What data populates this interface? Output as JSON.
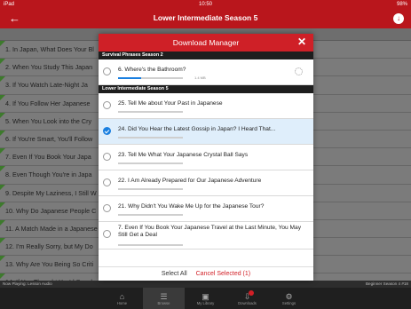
{
  "status": {
    "carrier": "iPad",
    "time": "10:50",
    "battery": "98%"
  },
  "navbar": {
    "title": "Lower Intermediate Season 5",
    "back_icon": "back-arrow-icon",
    "download_icon": "download-icon"
  },
  "background_list": [
    "1. In Japan, What Does Your Bl",
    "2. When You Study This Japan",
    "3. If You Watch Late-Night Ja",
    "4. If You Follow Her Japanese",
    "5. When You Look into the Cry",
    "6. If You're Smart, You'll Follow",
    "7. Even If You Book Your Japa",
    "8. Even Though You're in Japa",
    "9. Despite My Laziness, I Still W",
    "10. Why Do Japanese People C",
    "11. A Match Made in a Japanese",
    "12. I'm Really Sorry, but My Do",
    "13. Why Are You Being So Criti",
    "14. If You Thought You'd Speak"
  ],
  "modal": {
    "title": "Download Manager",
    "close_icon": "close-icon",
    "sections": [
      {
        "name": "Survival Phrases Season 2",
        "items": [
          {
            "label": "6. Where's the Bathroom?",
            "size": "1.4 MB",
            "progress": 0.35,
            "downloading": true,
            "selected": false
          }
        ]
      },
      {
        "name": "Lower Intermediate Season 5",
        "items": [
          {
            "label": "25. Tell Me about Your Past in Japanese",
            "progress": 0,
            "selected": false
          },
          {
            "label": "24. Did You Hear the Latest Gossip in Japan? I Heard That...",
            "progress": 0,
            "selected": true
          },
          {
            "label": "23. Tell Me What Your Japanese Crystal Ball Says",
            "progress": 0,
            "selected": false
          },
          {
            "label": "22. I Am Already Prepared for Our Japanese Adventure",
            "progress": 0,
            "selected": false
          },
          {
            "label": "21. Why Didn't You Wake Me Up for the Japanese Tour?",
            "progress": 0,
            "selected": false
          },
          {
            "label": "7. Even If You Book Your Japanese Travel at the Last Minute, You May Still Get a Deal",
            "progress": 0,
            "selected": false
          }
        ]
      }
    ],
    "select_all": "Select All",
    "cancel_selected": "Cancel Selected (1)"
  },
  "now_playing": {
    "left": "Now Playing: Lesson Audio",
    "right": "Beginner Season 4 #18"
  },
  "tabs": [
    {
      "label": "Home",
      "icon": "home-icon",
      "active": false
    },
    {
      "label": "Browse",
      "icon": "browse-icon",
      "active": true
    },
    {
      "label": "My Library",
      "icon": "library-icon",
      "active": false
    },
    {
      "label": "Downloads",
      "icon": "downloads-icon",
      "active": false,
      "badge": true
    },
    {
      "label": "Settings",
      "icon": "settings-icon",
      "active": false
    }
  ],
  "colors": {
    "brand_red": "#cf2027",
    "accent_blue": "#1a7fe0"
  }
}
